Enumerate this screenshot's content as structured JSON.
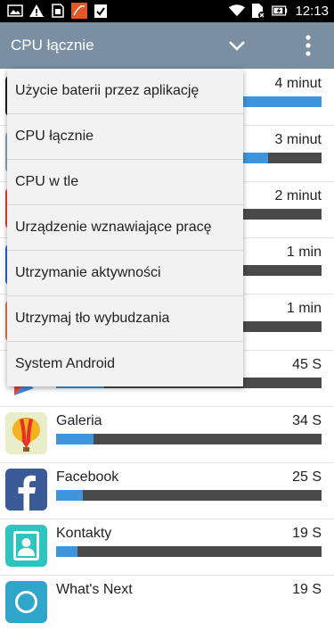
{
  "status_bar": {
    "time": "12:13",
    "icons_left": [
      "image-icon",
      "warning-icon",
      "sim-icon",
      "app-notification-icon",
      "clipboard-check-icon"
    ],
    "icons_right": [
      "wifi-icon",
      "sim-off-icon",
      "battery-charging-icon"
    ]
  },
  "toolbar": {
    "title": "CPU łącznie",
    "accent": "#7a8fa2"
  },
  "menu": {
    "items": [
      "Użycie baterii przez aplikację",
      "CPU łącznie",
      "CPU w tle",
      "Urządzenie wznawiające pracę",
      "Utrzymanie aktywności",
      "Utrzymaj tło wybudzania",
      "System Android"
    ]
  },
  "apps": [
    {
      "name": "",
      "value": "4 minut",
      "fill": 1.0
    },
    {
      "name": "",
      "value": "3 minut",
      "fill": 0.8
    },
    {
      "name": "",
      "value": "2 minut",
      "fill": 0.55
    },
    {
      "name": "",
      "value": "1 min",
      "fill": 0.3
    },
    {
      "name": "",
      "value": "1 min",
      "fill": 0.25
    },
    {
      "name": "",
      "value": "45 S",
      "fill": 0.18
    },
    {
      "name": "Galeria",
      "value": "34 S",
      "fill": 0.14
    },
    {
      "name": "Facebook",
      "value": "25 S",
      "fill": 0.1
    },
    {
      "name": "Kontakty",
      "value": "19 S",
      "fill": 0.08
    },
    {
      "name": "What's Next",
      "value": "19 S",
      "fill": 0.08
    }
  ],
  "colors": {
    "bar_fill": "#3f95dc",
    "bar_track": "#4a4a4a"
  }
}
